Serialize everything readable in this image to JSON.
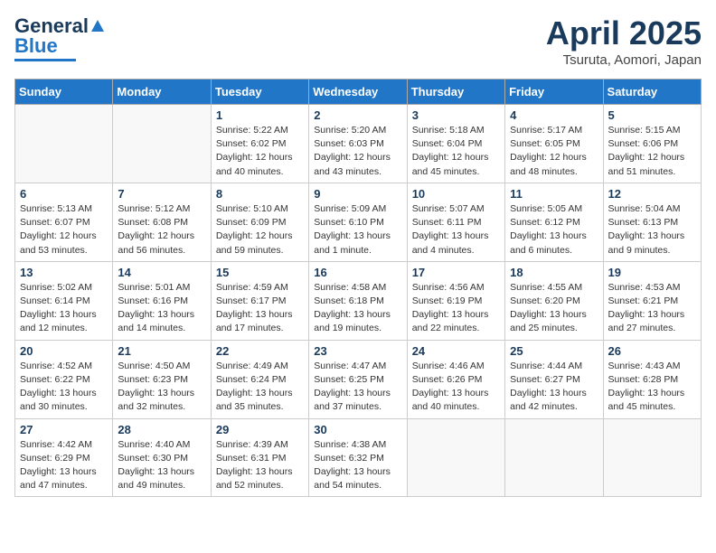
{
  "header": {
    "logo_general": "General",
    "logo_blue": "Blue",
    "month_year": "April 2025",
    "location": "Tsuruta, Aomori, Japan"
  },
  "days_of_week": [
    "Sunday",
    "Monday",
    "Tuesday",
    "Wednesday",
    "Thursday",
    "Friday",
    "Saturday"
  ],
  "weeks": [
    [
      {
        "day": "",
        "info": ""
      },
      {
        "day": "",
        "info": ""
      },
      {
        "day": "1",
        "info": "Sunrise: 5:22 AM\nSunset: 6:02 PM\nDaylight: 12 hours and 40 minutes."
      },
      {
        "day": "2",
        "info": "Sunrise: 5:20 AM\nSunset: 6:03 PM\nDaylight: 12 hours and 43 minutes."
      },
      {
        "day": "3",
        "info": "Sunrise: 5:18 AM\nSunset: 6:04 PM\nDaylight: 12 hours and 45 minutes."
      },
      {
        "day": "4",
        "info": "Sunrise: 5:17 AM\nSunset: 6:05 PM\nDaylight: 12 hours and 48 minutes."
      },
      {
        "day": "5",
        "info": "Sunrise: 5:15 AM\nSunset: 6:06 PM\nDaylight: 12 hours and 51 minutes."
      }
    ],
    [
      {
        "day": "6",
        "info": "Sunrise: 5:13 AM\nSunset: 6:07 PM\nDaylight: 12 hours and 53 minutes."
      },
      {
        "day": "7",
        "info": "Sunrise: 5:12 AM\nSunset: 6:08 PM\nDaylight: 12 hours and 56 minutes."
      },
      {
        "day": "8",
        "info": "Sunrise: 5:10 AM\nSunset: 6:09 PM\nDaylight: 12 hours and 59 minutes."
      },
      {
        "day": "9",
        "info": "Sunrise: 5:09 AM\nSunset: 6:10 PM\nDaylight: 13 hours and 1 minute."
      },
      {
        "day": "10",
        "info": "Sunrise: 5:07 AM\nSunset: 6:11 PM\nDaylight: 13 hours and 4 minutes."
      },
      {
        "day": "11",
        "info": "Sunrise: 5:05 AM\nSunset: 6:12 PM\nDaylight: 13 hours and 6 minutes."
      },
      {
        "day": "12",
        "info": "Sunrise: 5:04 AM\nSunset: 6:13 PM\nDaylight: 13 hours and 9 minutes."
      }
    ],
    [
      {
        "day": "13",
        "info": "Sunrise: 5:02 AM\nSunset: 6:14 PM\nDaylight: 13 hours and 12 minutes."
      },
      {
        "day": "14",
        "info": "Sunrise: 5:01 AM\nSunset: 6:16 PM\nDaylight: 13 hours and 14 minutes."
      },
      {
        "day": "15",
        "info": "Sunrise: 4:59 AM\nSunset: 6:17 PM\nDaylight: 13 hours and 17 minutes."
      },
      {
        "day": "16",
        "info": "Sunrise: 4:58 AM\nSunset: 6:18 PM\nDaylight: 13 hours and 19 minutes."
      },
      {
        "day": "17",
        "info": "Sunrise: 4:56 AM\nSunset: 6:19 PM\nDaylight: 13 hours and 22 minutes."
      },
      {
        "day": "18",
        "info": "Sunrise: 4:55 AM\nSunset: 6:20 PM\nDaylight: 13 hours and 25 minutes."
      },
      {
        "day": "19",
        "info": "Sunrise: 4:53 AM\nSunset: 6:21 PM\nDaylight: 13 hours and 27 minutes."
      }
    ],
    [
      {
        "day": "20",
        "info": "Sunrise: 4:52 AM\nSunset: 6:22 PM\nDaylight: 13 hours and 30 minutes."
      },
      {
        "day": "21",
        "info": "Sunrise: 4:50 AM\nSunset: 6:23 PM\nDaylight: 13 hours and 32 minutes."
      },
      {
        "day": "22",
        "info": "Sunrise: 4:49 AM\nSunset: 6:24 PM\nDaylight: 13 hours and 35 minutes."
      },
      {
        "day": "23",
        "info": "Sunrise: 4:47 AM\nSunset: 6:25 PM\nDaylight: 13 hours and 37 minutes."
      },
      {
        "day": "24",
        "info": "Sunrise: 4:46 AM\nSunset: 6:26 PM\nDaylight: 13 hours and 40 minutes."
      },
      {
        "day": "25",
        "info": "Sunrise: 4:44 AM\nSunset: 6:27 PM\nDaylight: 13 hours and 42 minutes."
      },
      {
        "day": "26",
        "info": "Sunrise: 4:43 AM\nSunset: 6:28 PM\nDaylight: 13 hours and 45 minutes."
      }
    ],
    [
      {
        "day": "27",
        "info": "Sunrise: 4:42 AM\nSunset: 6:29 PM\nDaylight: 13 hours and 47 minutes."
      },
      {
        "day": "28",
        "info": "Sunrise: 4:40 AM\nSunset: 6:30 PM\nDaylight: 13 hours and 49 minutes."
      },
      {
        "day": "29",
        "info": "Sunrise: 4:39 AM\nSunset: 6:31 PM\nDaylight: 13 hours and 52 minutes."
      },
      {
        "day": "30",
        "info": "Sunrise: 4:38 AM\nSunset: 6:32 PM\nDaylight: 13 hours and 54 minutes."
      },
      {
        "day": "",
        "info": ""
      },
      {
        "day": "",
        "info": ""
      },
      {
        "day": "",
        "info": ""
      }
    ]
  ]
}
